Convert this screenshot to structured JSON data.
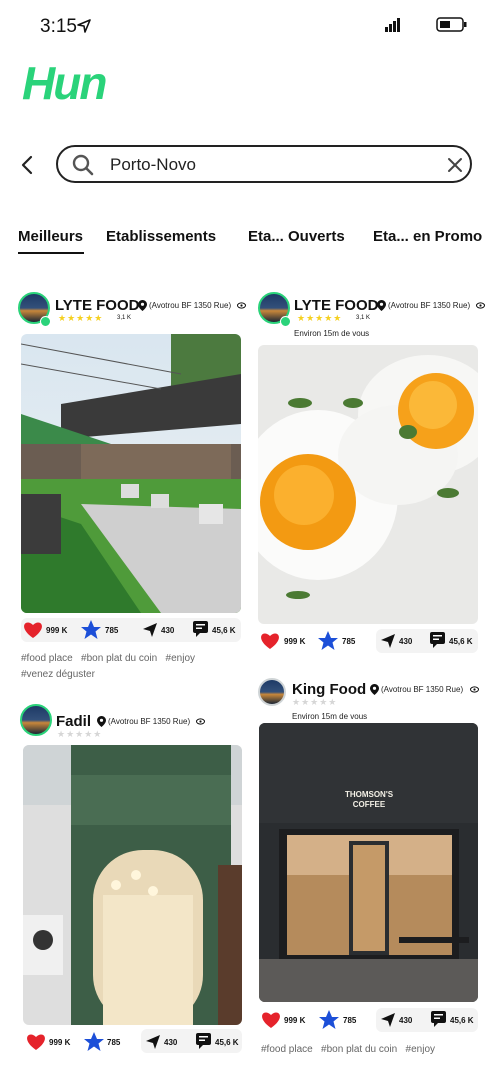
{
  "status": {
    "time": "3:15"
  },
  "app": {
    "logo": "Hun"
  },
  "search": {
    "value": "Porto-Novo"
  },
  "tabs": [
    {
      "label": "Meilleurs"
    },
    {
      "label": "Etablissements"
    },
    {
      "label": "Eta... Ouverts"
    },
    {
      "label": "Eta... en Promo"
    }
  ],
  "cards": [
    {
      "name": "LYTE FOOD",
      "address": "(Avotrou BF 1350 Rue)",
      "rating_count": "3,1 K",
      "likes": "999 K",
      "favorites": "785",
      "shares": "430",
      "comments": "45,6 K",
      "tags_line1": "#food place   #bon plat du coin   #enjoy",
      "tags_line2": "#venez déguster"
    },
    {
      "name": "LYTE FOOD",
      "address": "(Avotrou BF 1350 Rue)",
      "rating_count": "3,1 K",
      "distance": "Environ 15m de vous",
      "likes": "999 K",
      "favorites": "785",
      "shares": "430",
      "comments": "45,6 K"
    },
    {
      "name": "Fadil",
      "address": "(Avotrou BF 1350 Rue)",
      "likes": "999 K",
      "favorites": "785",
      "shares": "430",
      "comments": "45,6 K"
    },
    {
      "name": "King Food",
      "address": "(Avotrou BF 1350 Rue)",
      "distance": "Environ 15m de vous",
      "likes": "999 K",
      "favorites": "785",
      "shares": "430",
      "comments": "45,6 K",
      "tags_line1": "#food place   #bon plat du coin   #enjoy"
    }
  ],
  "colors": {
    "accent_blue": "#3a6df0",
    "accent_green": "#2ad37a",
    "heart": "#e5232b",
    "star_fav": "#1c4fd8",
    "rating_star": "#f5d020"
  }
}
